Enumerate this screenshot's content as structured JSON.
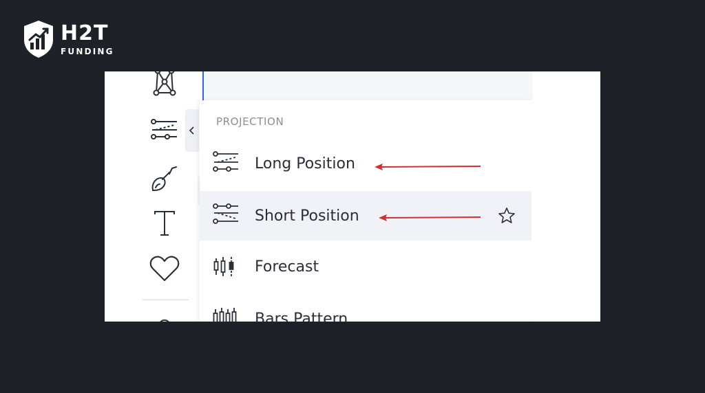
{
  "brand": {
    "name": "H2T",
    "sub": "FUNDING"
  },
  "menu": {
    "header": "PROJECTION",
    "items": [
      {
        "label": "Long Position",
        "icon": "long-position-icon",
        "highlighted": false
      },
      {
        "label": "Short Position",
        "icon": "short-position-icon",
        "highlighted": true
      },
      {
        "label": "Forecast",
        "icon": "forecast-icon",
        "highlighted": false
      },
      {
        "label": "Bars Pattern",
        "icon": "bars-pattern-icon",
        "highlighted": false
      }
    ]
  },
  "watermark": "H2T FUNDING",
  "colors": {
    "background": "#1f2128",
    "panel": "#ffffff",
    "highlight_row": "#f0f2f7",
    "annotation_arrow": "#d32f2f",
    "accent_focus": "#2962ff"
  }
}
